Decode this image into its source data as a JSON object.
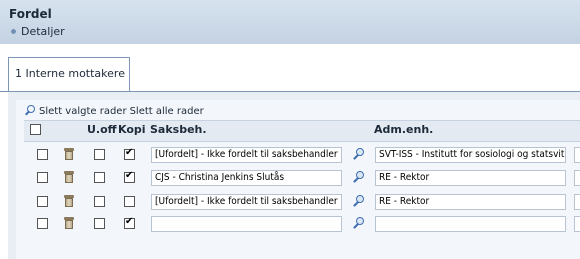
{
  "window": {
    "title": "Fordel",
    "details_label": "Detaljer"
  },
  "tab": {
    "number": "1",
    "label": "Interne mottakere"
  },
  "actions": {
    "delete_selected": "Slett valgte rader",
    "delete_all": "Slett alle rader"
  },
  "columns": {
    "uoff": "U.off",
    "kopi": "Kopi",
    "saksbeh": "Saksbeh.",
    "admenh": "Adm.enh."
  },
  "rows": [
    {
      "select": false,
      "uoff": false,
      "kopi": true,
      "saksbeh": "[Ufordelt] - Ikke fordelt til saksbehandler",
      "admenh": "SVT-ISS - Institutt for sosiologi og statsvit"
    },
    {
      "select": false,
      "uoff": false,
      "kopi": true,
      "saksbeh": "CJS - Christina Jenkins Slutås",
      "admenh": "RE - Rektor"
    },
    {
      "select": false,
      "uoff": false,
      "kopi": false,
      "saksbeh": "[Ufordelt] - Ikke fordelt til saksbehandler",
      "admenh": "RE - Rektor"
    },
    {
      "select": false,
      "uoff": false,
      "kopi": true,
      "saksbeh": "",
      "admenh": ""
    }
  ]
}
